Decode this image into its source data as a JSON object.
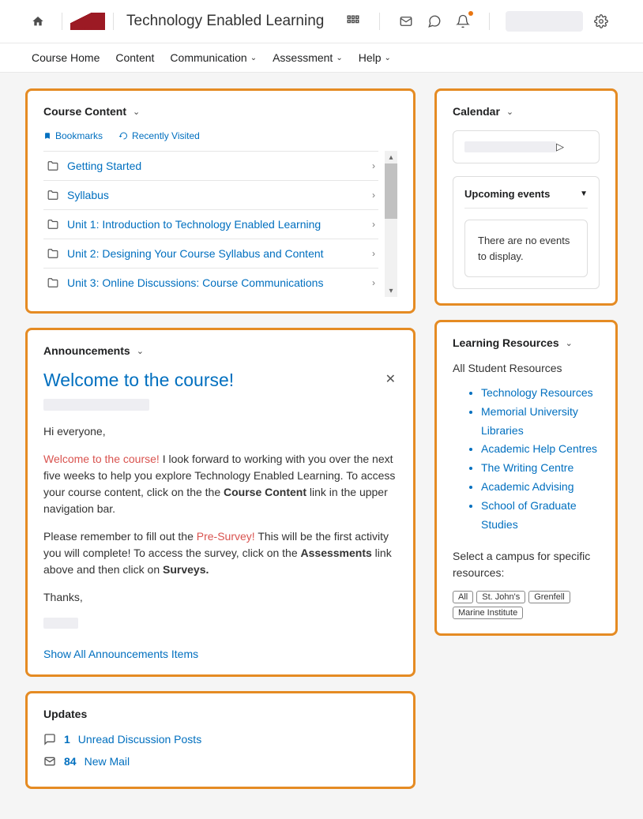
{
  "header": {
    "course_title": "Technology Enabled Learning"
  },
  "nav": {
    "items": [
      {
        "label": "Course Home",
        "dropdown": false
      },
      {
        "label": "Content",
        "dropdown": false
      },
      {
        "label": "Communication",
        "dropdown": true
      },
      {
        "label": "Assessment",
        "dropdown": true
      },
      {
        "label": "Help",
        "dropdown": true
      }
    ]
  },
  "course_content": {
    "title": "Course Content",
    "bookmarks_label": "Bookmarks",
    "recently_visited_label": "Recently Visited",
    "items": [
      {
        "label": "Getting Started"
      },
      {
        "label": "Syllabus"
      },
      {
        "label": "Unit 1: Introduction to Technology Enabled Learning"
      },
      {
        "label": "Unit 2: Designing Your Course Syllabus and Content"
      },
      {
        "label": "Unit 3: Online Discussions: Course Communications"
      }
    ]
  },
  "announcements": {
    "title": "Announcements",
    "item_title": "Welcome to the course!",
    "greeting": "Hi everyone,",
    "intro_highlight": "Welcome to the course!",
    "intro_rest": " I look forward to working with you over the next five weeks to help you explore Technology Enabled Learning. To access your course content, click on the the ",
    "intro_bold": "Course Content",
    "intro_end": " link in the upper navigation bar.",
    "p2_start": "Please remember to fill out the ",
    "p2_highlight": "Pre-Survey!",
    "p2_mid": " This will be the first activity you will complete! To access the survey, click on the ",
    "p2_bold": "Assessments",
    "p2_mid2": " link above and then click on ",
    "p2_bold2": "Surveys.",
    "thanks": "Thanks,",
    "show_all": "Show All Announcements Items"
  },
  "updates": {
    "title": "Updates",
    "items": [
      {
        "count": "1",
        "label": "Unread Discussion Posts",
        "icon": "discussion"
      },
      {
        "count": "84",
        "label": "New Mail",
        "icon": "mail"
      }
    ]
  },
  "calendar": {
    "title": "Calendar",
    "upcoming_title": "Upcoming events",
    "no_events": "There are no events to display."
  },
  "learning_resources": {
    "title": "Learning Resources",
    "all_students": "All Student Resources",
    "links": [
      "Technology Resources",
      "Memorial University Libraries",
      "Academic Help Centres",
      "The Writing Centre",
      "Academic Advising",
      "School of Graduate Studies"
    ],
    "campus_label": "Select a campus for specific resources:",
    "campuses": [
      "All",
      "St. John's",
      "Grenfell",
      "Marine Institute"
    ]
  }
}
